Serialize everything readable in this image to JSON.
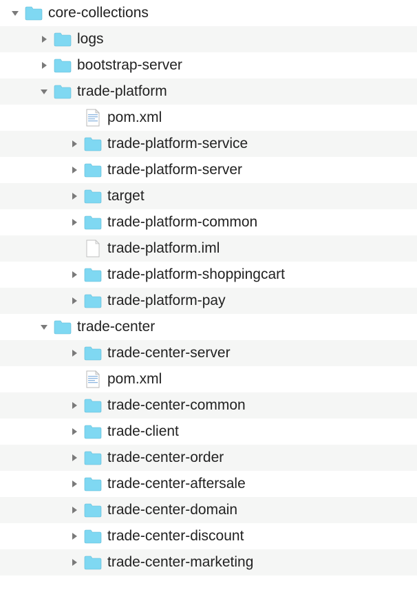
{
  "tree": [
    {
      "indent": 0,
      "expand": "down",
      "icon": "folder",
      "label": "core-collections"
    },
    {
      "indent": 1,
      "expand": "right",
      "icon": "folder",
      "label": "logs"
    },
    {
      "indent": 1,
      "expand": "right",
      "icon": "folder",
      "label": "bootstrap-server"
    },
    {
      "indent": 1,
      "expand": "down",
      "icon": "folder",
      "label": "trade-platform"
    },
    {
      "indent": 2,
      "expand": "none",
      "icon": "xml",
      "label": "pom.xml"
    },
    {
      "indent": 2,
      "expand": "right",
      "icon": "folder",
      "label": "trade-platform-service"
    },
    {
      "indent": 2,
      "expand": "right",
      "icon": "folder",
      "label": "trade-platform-server"
    },
    {
      "indent": 2,
      "expand": "right",
      "icon": "folder",
      "label": "target"
    },
    {
      "indent": 2,
      "expand": "right",
      "icon": "folder",
      "label": "trade-platform-common"
    },
    {
      "indent": 2,
      "expand": "none",
      "icon": "file",
      "label": "trade-platform.iml"
    },
    {
      "indent": 2,
      "expand": "right",
      "icon": "folder",
      "label": "trade-platform-shoppingcart"
    },
    {
      "indent": 2,
      "expand": "right",
      "icon": "folder",
      "label": "trade-platform-pay"
    },
    {
      "indent": 1,
      "expand": "down",
      "icon": "folder",
      "label": "trade-center"
    },
    {
      "indent": 2,
      "expand": "right",
      "icon": "folder",
      "label": "trade-center-server"
    },
    {
      "indent": 2,
      "expand": "none",
      "icon": "xml",
      "label": "pom.xml"
    },
    {
      "indent": 2,
      "expand": "right",
      "icon": "folder",
      "label": "trade-center-common"
    },
    {
      "indent": 2,
      "expand": "right",
      "icon": "folder",
      "label": "trade-client"
    },
    {
      "indent": 2,
      "expand": "right",
      "icon": "folder",
      "label": "trade-center-order"
    },
    {
      "indent": 2,
      "expand": "right",
      "icon": "folder",
      "label": "trade-center-aftersale"
    },
    {
      "indent": 2,
      "expand": "right",
      "icon": "folder",
      "label": "trade-center-domain"
    },
    {
      "indent": 2,
      "expand": "right",
      "icon": "folder",
      "label": "trade-center-discount"
    },
    {
      "indent": 2,
      "expand": "right",
      "icon": "folder",
      "label": "trade-center-marketing"
    }
  ]
}
